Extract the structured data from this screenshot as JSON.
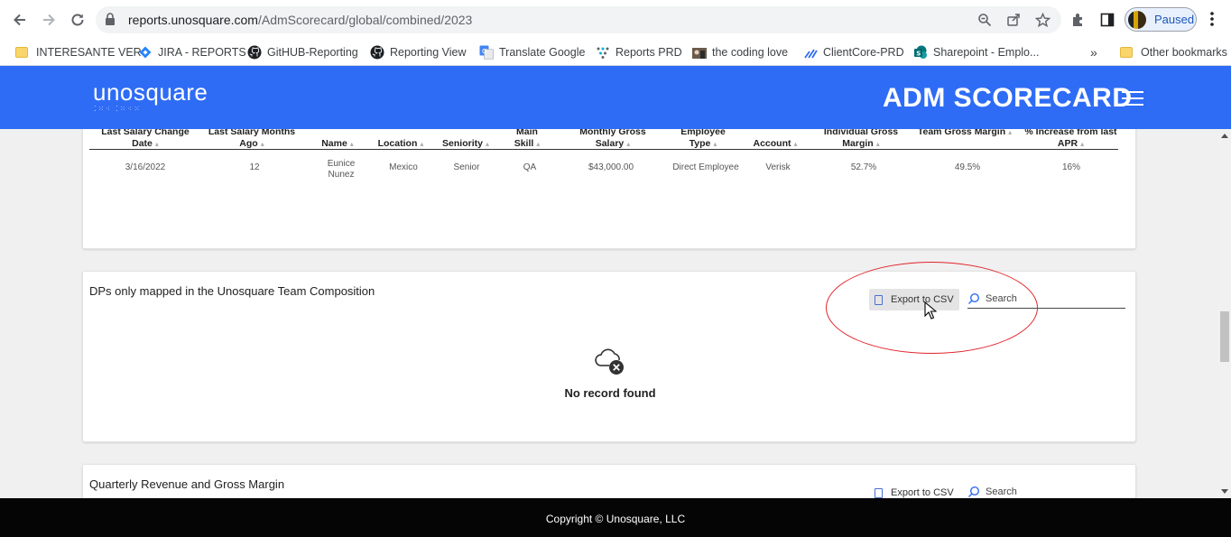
{
  "browser": {
    "url_host": "reports.unosquare.com",
    "url_path": "/AdmScorecard/global/combined/2023",
    "profile_label": "Paused",
    "bookmarks": [
      {
        "label": "INTERESANTE VER",
        "icon": "folder-icon"
      },
      {
        "label": "JIRA - REPORTS",
        "icon": "jira-icon"
      },
      {
        "label": "GitHUB-Reporting",
        "icon": "github-icon"
      },
      {
        "label": "Reporting View",
        "icon": "github-icon"
      },
      {
        "label": "Translate Google",
        "icon": "translate-icon"
      },
      {
        "label": "Reports PRD",
        "icon": "reports-icon"
      },
      {
        "label": "the coding love",
        "icon": "coding-love-icon"
      },
      {
        "label": "ClientCore-PRD",
        "icon": "clientcore-icon"
      },
      {
        "label": "Sharepoint - Emplo...",
        "icon": "sharepoint-icon"
      }
    ],
    "other_bookmarks": "Other bookmarks"
  },
  "header": {
    "logo": "unosquare",
    "title": "ADM SCORECARD"
  },
  "table1": {
    "columns": [
      "Last Salary Change Date",
      "Last Salary Months Ago",
      "Name",
      "Location",
      "Seniority",
      "Main Skill",
      "Monthly Gross Salary",
      "Employee Type",
      "Account",
      "Individual Gross Margin",
      "Team Gross Margin",
      "% Increase from last APR"
    ],
    "rows": [
      [
        "3/16/2022",
        "12",
        "Eunice Nunez",
        "Mexico",
        "Senior",
        "QA",
        "$43,000.00",
        "Direct Employee",
        "Verisk",
        "52.7%",
        "49.5%",
        "16%"
      ]
    ]
  },
  "section2": {
    "title": "DPs only mapped in the Unosquare Team Composition",
    "export_label": "Export to CSV",
    "search_placeholder": "Search",
    "empty_text": "No record found"
  },
  "section3": {
    "title": "Quarterly Revenue and Gross Margin",
    "export_label": "Export to CSV",
    "search_placeholder": "Search"
  },
  "footer": {
    "copyright": "Copyright © Unosquare, LLC"
  },
  "colors": {
    "header_bg": "#2e6cf6",
    "annotation": "#e0242b"
  }
}
